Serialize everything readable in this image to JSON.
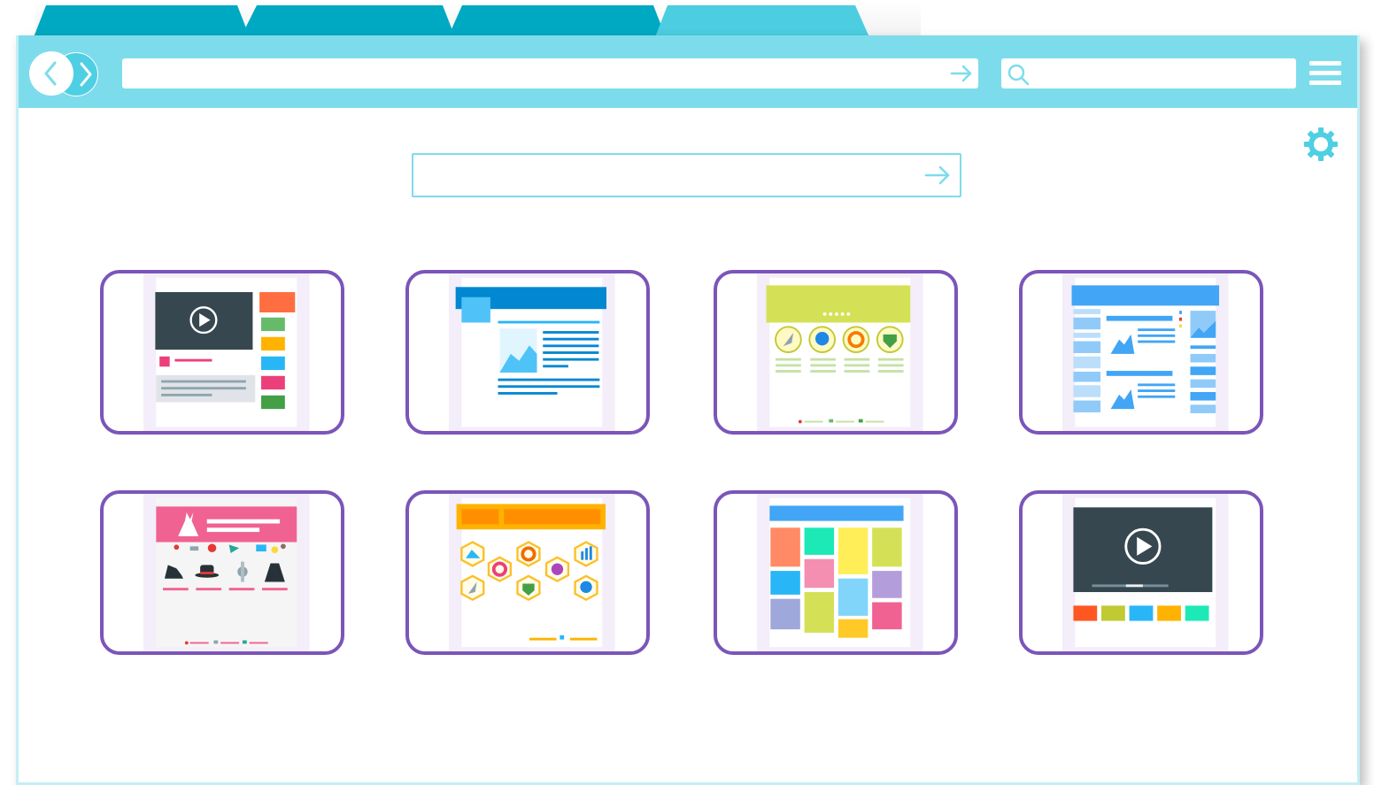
{
  "tabs": [
    {
      "label": "",
      "color": "#00a9c2"
    },
    {
      "label": "",
      "color": "#00a9c2"
    },
    {
      "label": "",
      "color": "#00a9c2"
    },
    {
      "label": "",
      "color": "#4ccde0"
    }
  ],
  "toolbar": {
    "address_value": "",
    "address_placeholder": "",
    "search_value": "",
    "search_placeholder": ""
  },
  "icons": {
    "back": "chevron-left-icon",
    "forward": "chevron-right-icon",
    "go": "arrow-right-icon",
    "search": "search-icon",
    "menu": "hamburger-menu-icon",
    "settings": "gear-icon"
  },
  "center_search": {
    "value": "",
    "placeholder": ""
  },
  "tiles": [
    {
      "name": "video-site",
      "label": ""
    },
    {
      "name": "article-site",
      "label": ""
    },
    {
      "name": "badges-site",
      "label": ""
    },
    {
      "name": "blog-site",
      "label": ""
    },
    {
      "name": "shop-site",
      "label": ""
    },
    {
      "name": "hexagon-icons-site",
      "label": ""
    },
    {
      "name": "mosaic-site",
      "label": ""
    },
    {
      "name": "video-player-site",
      "label": ""
    }
  ],
  "colors": {
    "toolbar": "#7ddceb",
    "tab_active": "#4ccde0",
    "tab_inactive": "#00a9c2",
    "tile_border": "#7b55b9",
    "accent": "#4fcfe3"
  }
}
